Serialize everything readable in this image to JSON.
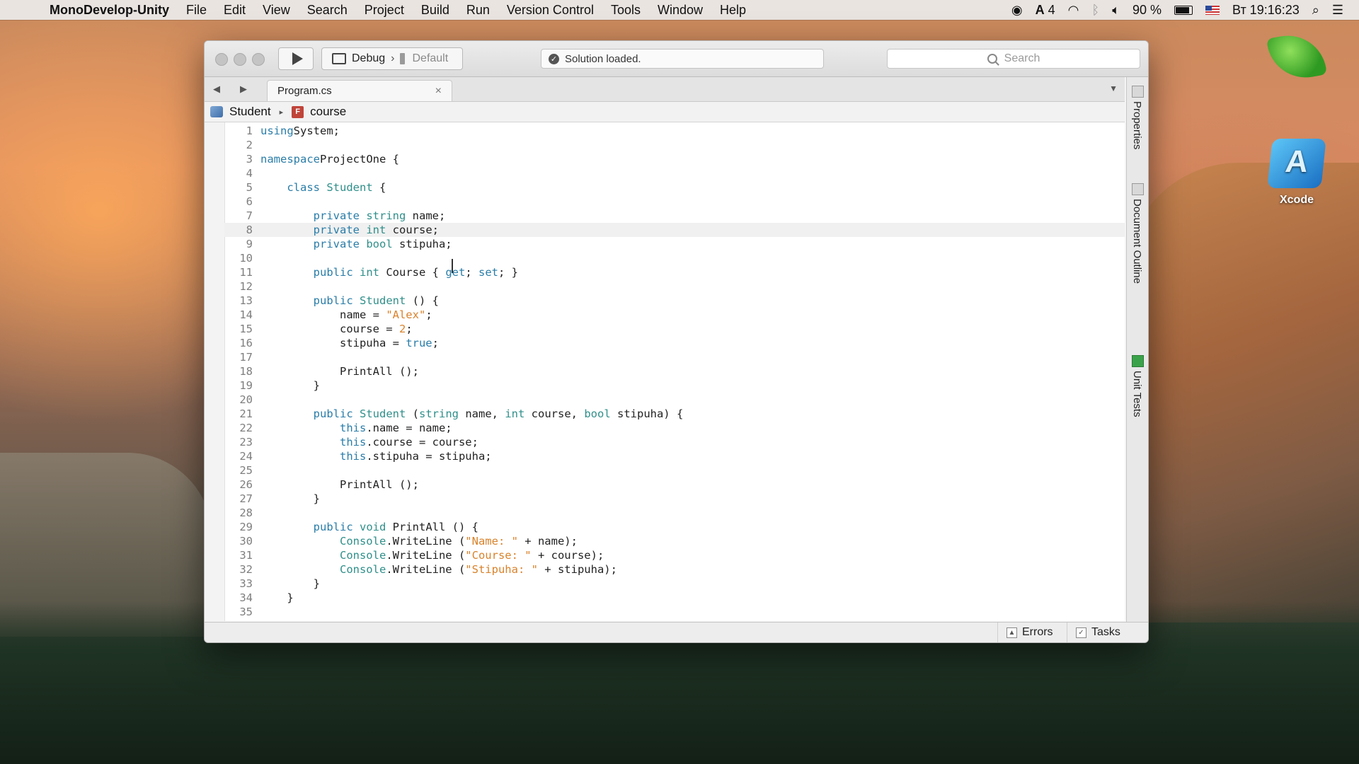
{
  "menubar": {
    "app_name": "MonoDevelop-Unity",
    "items": [
      "File",
      "Edit",
      "View",
      "Search",
      "Project",
      "Build",
      "Run",
      "Version Control",
      "Tools",
      "Window",
      "Help"
    ],
    "battery": "90 %",
    "clock": "Вт 19:16:23",
    "adobe_count": "4"
  },
  "toolbar": {
    "config": "Debug",
    "separator": "›",
    "device": "Default",
    "status": "Solution loaded.",
    "search_placeholder": "Search"
  },
  "tab": {
    "title": "Program.cs",
    "close": "×"
  },
  "breadcrumb": {
    "class": "Student",
    "arrow": "▸",
    "member": "course"
  },
  "side_pads": [
    "Properties",
    "Document Outline",
    "Unit Tests"
  ],
  "bottom_pads": {
    "errors": "Errors",
    "tasks": "Tasks"
  },
  "desktop": {
    "xcode_label": "Xcode"
  },
  "editor": {
    "current_line": 8,
    "lines": [
      [
        [
          "kw",
          "using"
        ],
        [
          "",
          "System;"
        ]
      ],
      [],
      [
        [
          "kw",
          "namespace"
        ],
        [
          "",
          "ProjectOne {"
        ]
      ],
      [],
      [
        [
          "",
          "    "
        ],
        [
          "kw",
          "class"
        ],
        [
          "",
          ""
        ],
        [
          "ty",
          "Student"
        ],
        [
          "",
          " {"
        ]
      ],
      [],
      [
        [
          "",
          "        "
        ],
        [
          "kw",
          "private"
        ],
        [
          "",
          ""
        ],
        [
          "ty",
          "string"
        ],
        [
          "",
          " name;"
        ]
      ],
      [
        [
          "",
          "        "
        ],
        [
          "kw",
          "private"
        ],
        [
          "",
          ""
        ],
        [
          "ty",
          "int"
        ],
        [
          "",
          " course;"
        ]
      ],
      [
        [
          "",
          "        "
        ],
        [
          "kw",
          "private"
        ],
        [
          "",
          ""
        ],
        [
          "ty",
          "bool"
        ],
        [
          "",
          " stipuha;"
        ]
      ],
      [],
      [
        [
          "",
          "        "
        ],
        [
          "kw",
          "public"
        ],
        [
          "",
          ""
        ],
        [
          "ty",
          "int"
        ],
        [
          "",
          " Course { "
        ],
        [
          "kw",
          "get"
        ],
        [
          "",
          "; "
        ],
        [
          "kw",
          "set"
        ],
        [
          "",
          "; }"
        ]
      ],
      [],
      [
        [
          "",
          "        "
        ],
        [
          "kw",
          "public"
        ],
        [
          "",
          ""
        ],
        [
          "ty",
          "Student"
        ],
        [
          "",
          " () {"
        ]
      ],
      [
        [
          "",
          "            name = "
        ],
        [
          "str",
          "\"Alex\""
        ],
        [
          "",
          ";"
        ]
      ],
      [
        [
          "",
          "            course = "
        ],
        [
          "num",
          "2"
        ],
        [
          "",
          ";"
        ]
      ],
      [
        [
          "",
          "            stipuha = "
        ],
        [
          "kw",
          "true"
        ],
        [
          "",
          ";"
        ]
      ],
      [],
      [
        [
          "",
          "            PrintAll ();"
        ]
      ],
      [
        [
          "",
          "        }"
        ]
      ],
      [],
      [
        [
          "",
          "        "
        ],
        [
          "kw",
          "public"
        ],
        [
          "",
          ""
        ],
        [
          "ty",
          "Student"
        ],
        [
          "",
          " ("
        ],
        [
          "ty",
          "string"
        ],
        [
          "",
          " name, "
        ],
        [
          "ty",
          "int"
        ],
        [
          "",
          " course, "
        ],
        [
          "ty",
          "bool"
        ],
        [
          "",
          " stipuha) {"
        ]
      ],
      [
        [
          "",
          "            "
        ],
        [
          "kw",
          "this"
        ],
        [
          "",
          ".name = name;"
        ]
      ],
      [
        [
          "",
          "            "
        ],
        [
          "kw",
          "this"
        ],
        [
          "",
          ".course = course;"
        ]
      ],
      [
        [
          "",
          "            "
        ],
        [
          "kw",
          "this"
        ],
        [
          "",
          ".stipuha = stipuha;"
        ]
      ],
      [],
      [
        [
          "",
          "            PrintAll ();"
        ]
      ],
      [
        [
          "",
          "        }"
        ]
      ],
      [],
      [
        [
          "",
          "        "
        ],
        [
          "kw",
          "public"
        ],
        [
          "",
          ""
        ],
        [
          "ty",
          "void"
        ],
        [
          "",
          " PrintAll () {"
        ]
      ],
      [
        [
          "",
          "            "
        ],
        [
          "ty",
          "Console"
        ],
        [
          "",
          ".WriteLine ("
        ],
        [
          "str",
          "\"Name: \""
        ],
        [
          "",
          " + name);"
        ]
      ],
      [
        [
          "",
          "            "
        ],
        [
          "ty",
          "Console"
        ],
        [
          "",
          ".WriteLine ("
        ],
        [
          "str",
          "\"Course: \""
        ],
        [
          "",
          " + course);"
        ]
      ],
      [
        [
          "",
          "            "
        ],
        [
          "ty",
          "Console"
        ],
        [
          "",
          ".WriteLine ("
        ],
        [
          "str",
          "\"Stipuha: \""
        ],
        [
          "",
          " + stipuha);"
        ]
      ],
      [
        [
          "",
          "        }"
        ]
      ],
      [
        [
          "",
          "    }"
        ]
      ],
      []
    ]
  }
}
